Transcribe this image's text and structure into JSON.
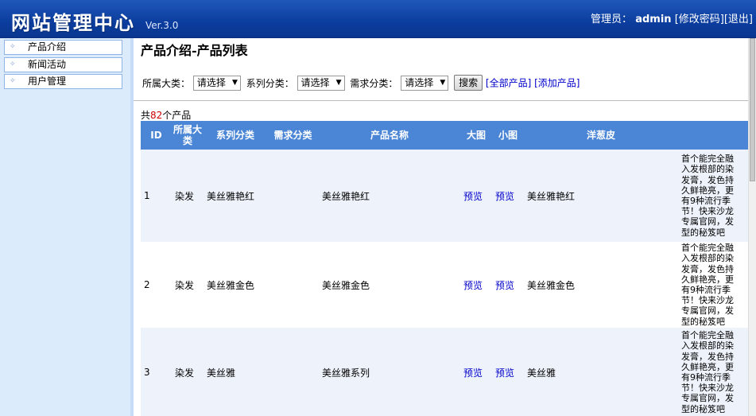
{
  "header": {
    "logo": "网站管理中心",
    "version": "Ver.3.0",
    "admin_label": "管理员：",
    "admin_name": "admin",
    "change_password": "[修改密码]",
    "logout": "[退出]"
  },
  "sidebar": {
    "items": [
      {
        "label": "产品介绍"
      },
      {
        "label": "新闻活动"
      },
      {
        "label": "用户管理"
      }
    ]
  },
  "main": {
    "title": "产品介绍-产品列表",
    "filter": {
      "category_label": "所属大类：",
      "category_value": "请选择",
      "series_label": "系列分类：",
      "series_value": "请选择",
      "demand_label": "需求分类：",
      "demand_value": "请选择",
      "search_button": "搜索",
      "all_products_link": "[全部产品]",
      "add_product_link": "[添加产品]"
    },
    "total_prefix": "共",
    "total_count": "82",
    "total_suffix": "个产品",
    "table": {
      "headers": [
        "ID",
        "所属大类",
        "系列分类",
        "需求分类",
        "产品名称",
        "大图",
        "小图",
        "洋葱皮",
        ""
      ],
      "rows": [
        {
          "id": "1",
          "category": "染发",
          "series": "美丝雅艳红",
          "demand": "",
          "name": "美丝雅艳红",
          "big": "预览",
          "small": "预览",
          "onion": "美丝雅艳红",
          "desc": "首个能完全融入发根部的染发膏，发色持久鲜艳亮，更有9种流行季节！快来沙龙专属官网，发型的秘笈吧"
        },
        {
          "id": "2",
          "category": "染发",
          "series": "美丝雅金色",
          "demand": "",
          "name": "美丝雅金色",
          "big": "预览",
          "small": "预览",
          "onion": "美丝雅金色",
          "desc": "首个能完全融入发根部的染发膏，发色持久鲜艳亮，更有9种流行季节！快来沙龙专属官网，发型的秘笈吧"
        },
        {
          "id": "3",
          "category": "染发",
          "series": "美丝雅",
          "demand": "",
          "name": "美丝雅系列",
          "big": "预览",
          "small": "预览",
          "onion": "美丝雅",
          "desc": "首个能完全融入发根部的染发膏，发色持久鲜艳亮，更有9种流行季节！快来沙龙专属官网，发型的秘笈吧"
        }
      ]
    }
  }
}
